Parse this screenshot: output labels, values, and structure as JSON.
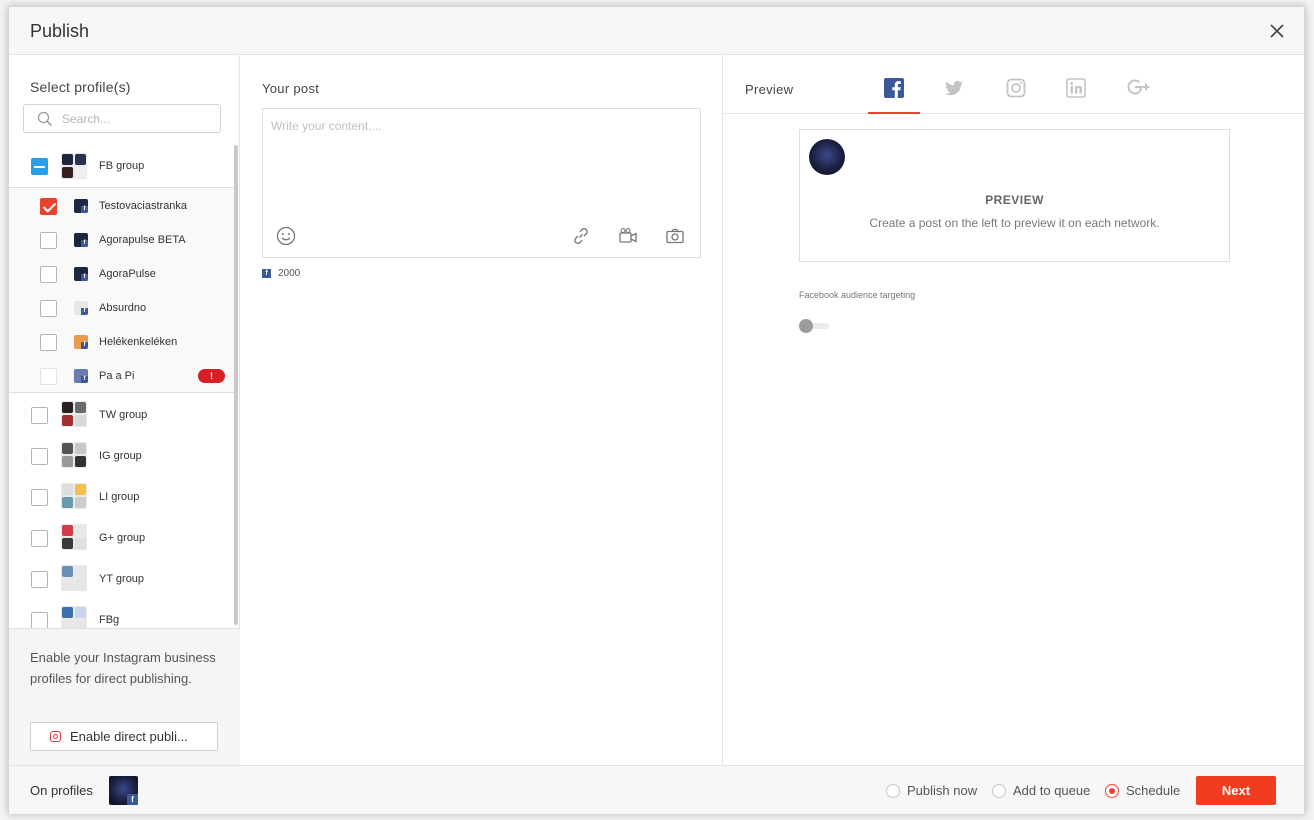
{
  "modal": {
    "title": "Publish"
  },
  "profiles": {
    "title": "Select profile(s)",
    "search_placeholder": "Search...",
    "fb_group": {
      "name": "FB group"
    },
    "fb_members": [
      {
        "name": "Testovaciastranka",
        "checked": true
      },
      {
        "name": "Agorapulse BETA",
        "checked": false
      },
      {
        "name": "AgoraPulse",
        "checked": false
      },
      {
        "name": "Absurdno",
        "checked": false
      },
      {
        "name": "Helékenkeléken",
        "checked": false
      },
      {
        "name": "Pa a Pi",
        "checked": false,
        "badge": "!"
      }
    ],
    "groups": [
      {
        "name": "TW group"
      },
      {
        "name": "IG group"
      },
      {
        "name": "LI group"
      },
      {
        "name": "G+ group"
      },
      {
        "name": "YT group"
      },
      {
        "name": "FBg"
      }
    ],
    "instagram_notice": "Enable your Instagram business profiles for direct publishing.",
    "enable_button": "Enable direct publi..."
  },
  "post": {
    "title": "Your post",
    "placeholder": "Write your content....",
    "char_count": "2000"
  },
  "preview": {
    "title": "Preview",
    "networks": [
      "facebook-icon",
      "twitter-icon",
      "instagram-icon",
      "linkedin-icon",
      "google-plus-icon"
    ],
    "active_network": "facebook",
    "card_title": "PREVIEW",
    "card_subtitle": "Create a post on the left to preview it on each network.",
    "audience_label": "Facebook audience targeting"
  },
  "footer": {
    "on_profiles": "On profiles",
    "options": [
      {
        "label": "Publish now",
        "selected": false
      },
      {
        "label": "Add to queue",
        "selected": false
      },
      {
        "label": "Schedule",
        "selected": true
      }
    ],
    "next": "Next"
  },
  "colors": {
    "accent": "#e8432e",
    "facebook": "#3b5998",
    "indeterminate": "#2a9de9",
    "badge": "#d91f26"
  }
}
